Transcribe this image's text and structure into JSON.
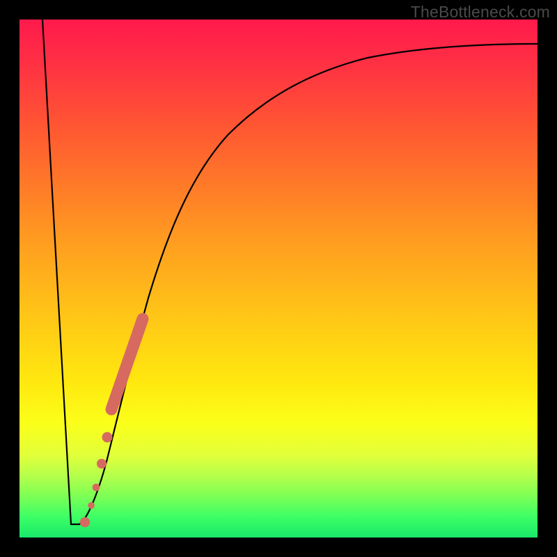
{
  "watermark": "TheBottleneck.com",
  "colors": {
    "curve_stroke": "#000000",
    "marker_fill": "#d66a60",
    "marker_stroke": "#d66a60"
  },
  "chart_data": {
    "type": "line",
    "title": "",
    "xlabel": "",
    "ylabel": "",
    "xlim": [
      0,
      100
    ],
    "ylim": [
      0,
      100
    ],
    "series": [
      {
        "name": "curve",
        "x": [
          4.5,
          10,
          11.5,
          13,
          15,
          17,
          19,
          22,
          26,
          30,
          35,
          41,
          48,
          56,
          65,
          75,
          85,
          95,
          100
        ],
        "y": [
          100,
          2.5,
          2.5,
          5,
          10,
          18,
          27,
          38,
          49,
          58,
          66,
          73,
          79,
          84,
          88,
          91,
          93,
          94.5,
          95
        ]
      }
    ],
    "markers": [
      {
        "segment": "thick",
        "x1": 18.5,
        "y1": 24.5,
        "x2": 23.5,
        "y2": 42.5,
        "width": 11
      },
      {
        "segment": "dot",
        "x": 17.2,
        "y": 19.0,
        "r": 5.0
      },
      {
        "segment": "dot",
        "x": 16.0,
        "y": 14.0,
        "r": 4.5
      },
      {
        "segment": "dot",
        "x": 14.8,
        "y": 9.5,
        "r": 3.6
      },
      {
        "segment": "dot",
        "x": 13.8,
        "y": 6.0,
        "r": 3.2
      },
      {
        "segment": "dot",
        "x": 12.6,
        "y": 3.0,
        "r": 4.8
      }
    ]
  }
}
